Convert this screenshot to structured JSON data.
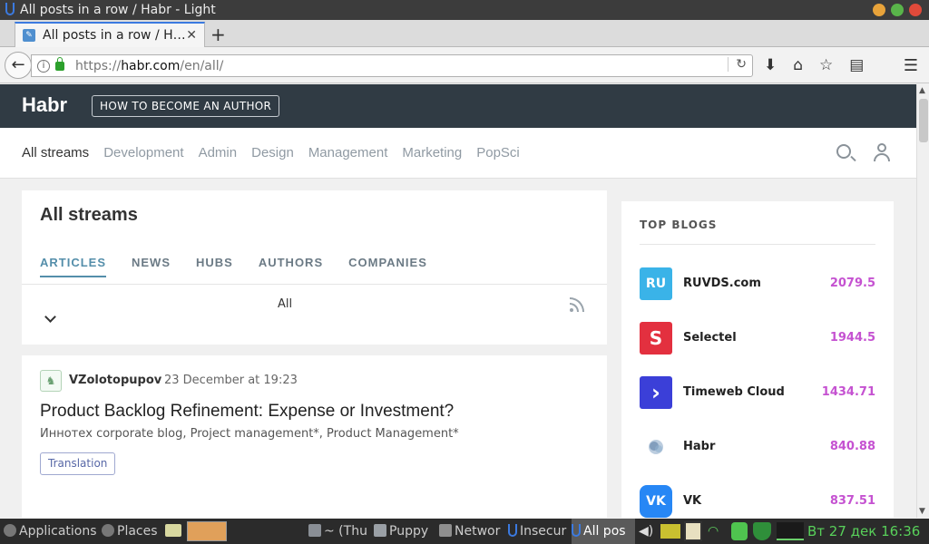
{
  "window": {
    "title": "All posts in a row / Habr - Light"
  },
  "browser": {
    "tab_title": "All posts in a row / H…",
    "url_prefix": "https://",
    "url_host": "habr.com",
    "url_path": "/en/all/"
  },
  "habr": {
    "logo": "Habr",
    "author_button": "HOW TO BECOME AN AUTHOR",
    "streams": [
      {
        "label": "All streams"
      },
      {
        "label": "Development"
      },
      {
        "label": "Admin"
      },
      {
        "label": "Design"
      },
      {
        "label": "Management"
      },
      {
        "label": "Marketing"
      },
      {
        "label": "PopSci"
      }
    ]
  },
  "main": {
    "heading": "All streams",
    "tabs": [
      {
        "label": "ARTICLES"
      },
      {
        "label": "NEWS"
      },
      {
        "label": "HUBS"
      },
      {
        "label": "AUTHORS"
      },
      {
        "label": "COMPANIES"
      }
    ],
    "filter_label": "All"
  },
  "post": {
    "author": "VZolotopupov",
    "date": "23 December at 19:23",
    "title": "Product Backlog Refinement: Expense or Investment?",
    "hubs": "Иннотех corporate blog,  Project management*,  Product Management*",
    "tag": "Translation"
  },
  "sidebar": {
    "heading": "TOP BLOGS",
    "blogs": [
      {
        "name": "RUVDS.com",
        "rating": "2079.5",
        "logo_text": "RU",
        "color": "#3ab3e8"
      },
      {
        "name": "Selectel",
        "rating": "1944.5",
        "logo_text": "S",
        "color": "#e3303f"
      },
      {
        "name": "Timeweb Cloud",
        "rating": "1434.71",
        "logo_text": "›",
        "color": "#3b3fd8"
      },
      {
        "name": "Habr",
        "rating": "840.88",
        "logo_text": "",
        "color": "#ffffff"
      },
      {
        "name": "VK",
        "rating": "837.51",
        "logo_text": "VK",
        "color": "#2787f5"
      }
    ]
  },
  "taskbar": {
    "items": [
      {
        "label": "Applications"
      },
      {
        "label": "Places"
      },
      {
        "label": "~ (Thu"
      },
      {
        "label": "Puppy"
      },
      {
        "label": "Networ"
      },
      {
        "label": "Insecur"
      },
      {
        "label": "All pos"
      }
    ],
    "clock": "Вт 27 дек 16:36"
  }
}
